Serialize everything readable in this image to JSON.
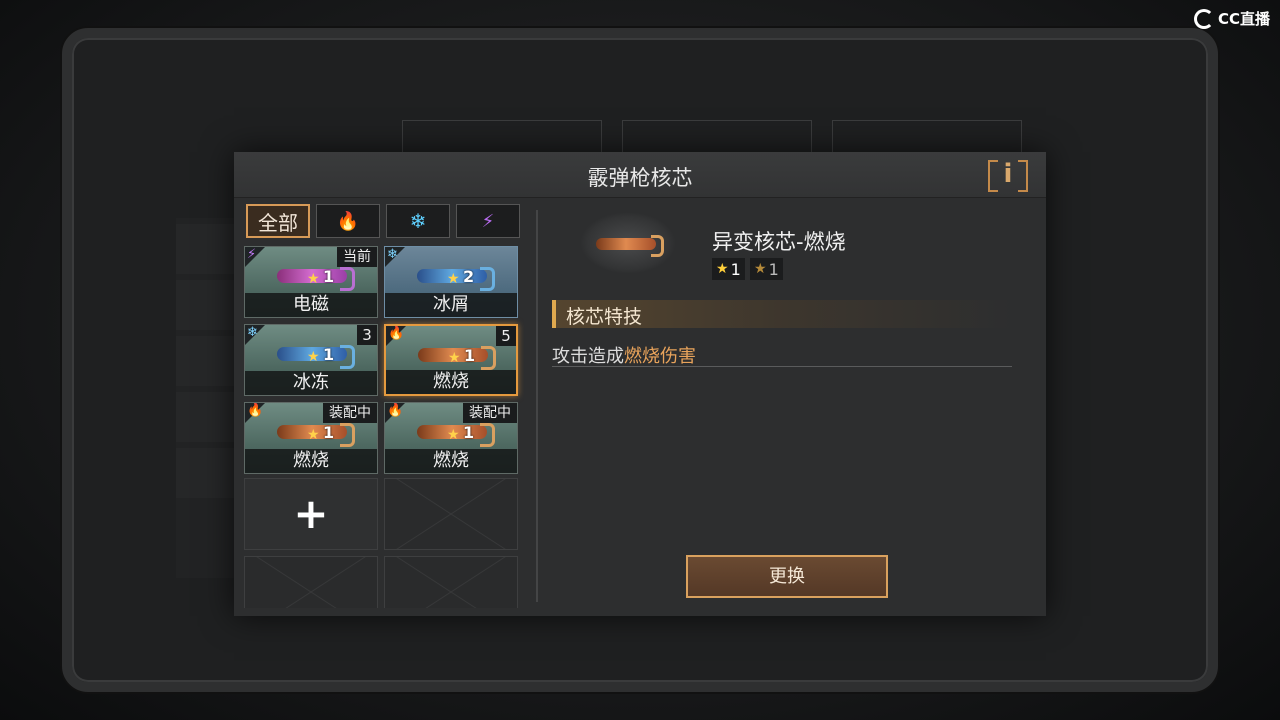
{
  "watermark": {
    "text": "CC直播"
  },
  "dialog": {
    "title": "霰弹枪核芯",
    "info_label": "i"
  },
  "filters": [
    {
      "label": "全部",
      "icon": "",
      "active": true
    },
    {
      "label": "",
      "icon": "fire-icon",
      "glyph": "🔥",
      "color": "#f08a3a",
      "active": false
    },
    {
      "label": "",
      "icon": "snowflake-icon",
      "glyph": "❄",
      "color": "#5fd0ff",
      "active": false
    },
    {
      "label": "",
      "icon": "lightning-icon",
      "glyph": "⚡",
      "color": "#b86cf0",
      "active": false
    }
  ],
  "cores": [
    {
      "name": "电磁",
      "element": "lightning-icon",
      "glyph": "⚡",
      "glyph_color": "#c07af5",
      "tag": "当前",
      "count": "",
      "level": "1",
      "style": "normal",
      "gun": "purple",
      "selected": false
    },
    {
      "name": "冰屑",
      "element": "ice-shard-icon",
      "glyph": "❄",
      "glyph_color": "#7fd4ff",
      "tag": "",
      "count": "",
      "level": "2",
      "style": "ice",
      "gun": "blue",
      "selected": false
    },
    {
      "name": "冰冻",
      "element": "snowflake-icon",
      "glyph": "❄",
      "glyph_color": "#7fd4ff",
      "tag": "",
      "count": "3",
      "level": "1",
      "style": "normal",
      "gun": "blue",
      "selected": false
    },
    {
      "name": "燃烧",
      "element": "fire-icon",
      "glyph": "🔥",
      "glyph_color": "#f08a3a",
      "tag": "",
      "count": "5",
      "level": "1",
      "style": "normal",
      "gun": "orange",
      "selected": true
    },
    {
      "name": "燃烧",
      "element": "fire-icon",
      "glyph": "🔥",
      "glyph_color": "#f08a3a",
      "tag": "装配中",
      "count": "",
      "level": "1",
      "style": "normal",
      "gun": "orange",
      "selected": false
    },
    {
      "name": "燃烧",
      "element": "fire-icon",
      "glyph": "🔥",
      "glyph_color": "#f08a3a",
      "tag": "装配中",
      "count": "",
      "level": "1",
      "style": "normal",
      "gun": "orange",
      "selected": false
    }
  ],
  "add_slot": {
    "icon": "plus-icon",
    "glyph": "+"
  },
  "detail": {
    "name": "异变核芯-燃烧",
    "star_primary": "1",
    "star_secondary": "1",
    "skill_title": "核芯特技",
    "skill_desc_prefix": "攻击造成",
    "skill_desc_highlight": "燃烧伤害",
    "highlight_color": "#e8a35b",
    "replace_label": "更换"
  },
  "colors": {
    "accent": "#d79a57",
    "selected_border": "#e59a3e"
  }
}
